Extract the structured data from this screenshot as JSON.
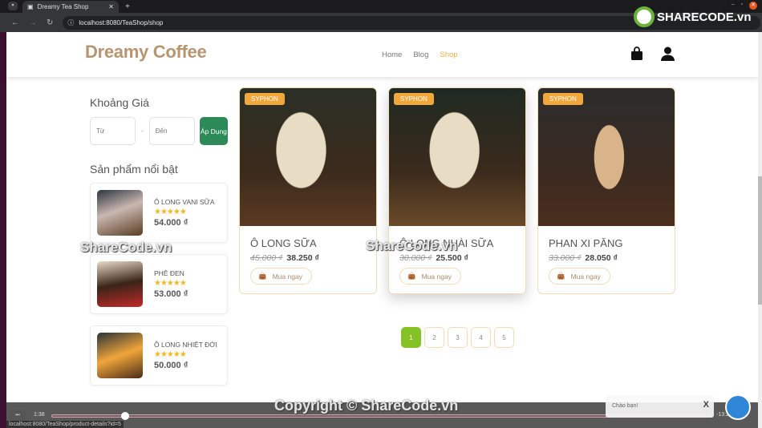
{
  "browser": {
    "tab_title": "Dreamy Tea Shop",
    "url": "localhost:8080/TeaShop/shop",
    "status_url": "localhost:8080/TeaShop/product-details?id=5"
  },
  "header": {
    "logo": "Dreamy Coffee",
    "menu": [
      {
        "label": "Home"
      },
      {
        "label": "Blog"
      },
      {
        "label": "Shop"
      }
    ],
    "active": "Shop"
  },
  "sidebar": {
    "price_title": "Khoảng Giá",
    "from_placeholder": "Từ",
    "separator": "-",
    "to_placeholder": "Đến",
    "apply_label": "Áp Dụng",
    "featured_title": "Sản phẩm nổi bật",
    "featured": [
      {
        "name": "Ô LONG VANI SỮA",
        "rating": 5,
        "stars": "★★★★★",
        "price": "54.000 ₫"
      },
      {
        "name": "PHÊ ĐEN",
        "rating": 5,
        "stars": "★★★★★",
        "price": "53.000 ₫"
      },
      {
        "name": "Ô LONG NHIỆT ĐỚI",
        "rating": 5,
        "stars": "★★★★★",
        "price": "50.000 ₫"
      }
    ]
  },
  "products": [
    {
      "badge": "SYPHON",
      "name": "Ô LONG SỮA",
      "old_price": "45.000 ₫",
      "price": "38.250 ₫",
      "buy_label": "Mua ngay"
    },
    {
      "badge": "SYPHON",
      "name": "Ô LONG NHÀI SỮA",
      "old_price": "30.000 ₫",
      "price": "25.500 ₫",
      "buy_label": "Mua ngay"
    },
    {
      "badge": "SYPHON",
      "name": "PHAN XI PĂNG",
      "old_price": "33.000 ₫",
      "price": "28.050 ₫",
      "buy_label": "Mua ngay"
    }
  ],
  "pagination": {
    "pages": [
      "1",
      "2",
      "3",
      "4",
      "5"
    ],
    "current": "1"
  },
  "video": {
    "elapsed": "1:38",
    "remaining": "-13:23",
    "progress_percent": 12
  },
  "chat": {
    "greeting": "Chào bạn!",
    "close": "X"
  },
  "watermark": {
    "text": "ShareCode.vn",
    "copyright": "Copyright © ShareCode.vn",
    "logo": "SHARECODE.vn"
  },
  "colors": {
    "brand": "#b89570",
    "accent": "#e8b24a",
    "apply": "#2b8a58",
    "page_active": "#84c225",
    "badge": "#f2a73b"
  }
}
